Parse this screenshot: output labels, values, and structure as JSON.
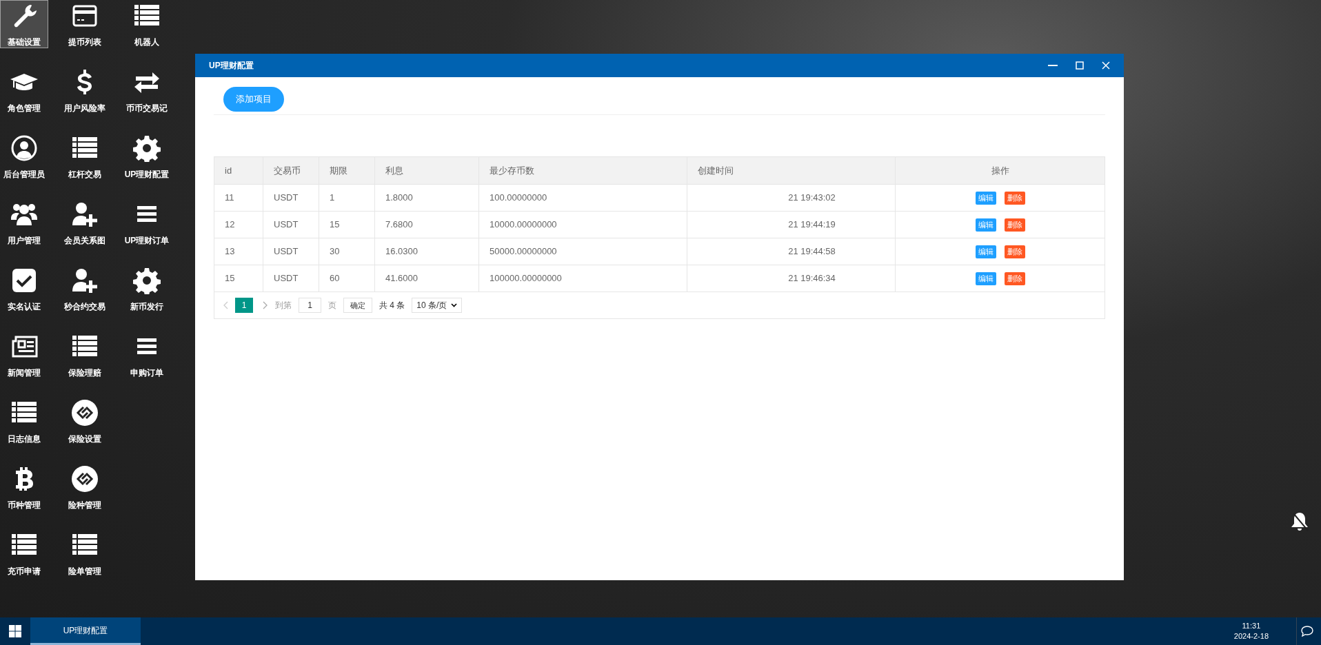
{
  "sidebar": {
    "rows": [
      {
        "items": [
          {
            "label": "基础设置",
            "kind": "wrench",
            "selected": true
          },
          {
            "label": "提币列表",
            "kind": "card",
            "selected": false
          },
          {
            "label": "机器人",
            "kind": "list",
            "selected": false
          }
        ]
      },
      {
        "items": [
          {
            "label": "角色管理",
            "kind": "cap",
            "selected": false
          },
          {
            "label": "用户风险率",
            "kind": "dollar",
            "selected": false
          },
          {
            "label": "币币交易记",
            "kind": "exchange",
            "selected": false
          }
        ]
      },
      {
        "items": [
          {
            "label": "后台管理员",
            "kind": "usercircle",
            "selected": false
          },
          {
            "label": "杠杆交易",
            "kind": "list",
            "selected": false
          },
          {
            "label": "UP理财配置",
            "kind": "gear",
            "selected": false
          }
        ]
      },
      {
        "items": [
          {
            "label": "用户管理",
            "kind": "users",
            "selected": false
          },
          {
            "label": "会员关系图",
            "kind": "useradd",
            "selected": false
          },
          {
            "label": "UP理财订单",
            "kind": "bars",
            "selected": false
          }
        ]
      },
      {
        "items": [
          {
            "label": "实名认证",
            "kind": "check",
            "selected": false
          },
          {
            "label": "秒合约交易",
            "kind": "useradd",
            "selected": false
          },
          {
            "label": "新币发行",
            "kind": "gear",
            "selected": false
          }
        ]
      },
      {
        "items": [
          {
            "label": "新闻管理",
            "kind": "news",
            "selected": false
          },
          {
            "label": "保险理赔",
            "kind": "list",
            "selected": false
          },
          {
            "label": "申购订单",
            "kind": "bars",
            "selected": false
          }
        ]
      },
      {
        "items": [
          {
            "label": "日志信息",
            "kind": "list",
            "selected": false
          },
          {
            "label": "保险设置",
            "kind": "link",
            "selected": false
          }
        ]
      },
      {
        "items": [
          {
            "label": "币种管理",
            "kind": "bitcoin",
            "selected": false
          },
          {
            "label": "险种管理",
            "kind": "link",
            "selected": false
          }
        ]
      },
      {
        "items": [
          {
            "label": "充币申请",
            "kind": "list",
            "selected": false
          },
          {
            "label": "险单管理",
            "kind": "list",
            "selected": false
          }
        ]
      }
    ]
  },
  "window": {
    "title": "UP理财配置",
    "add_button": "添加项目",
    "table": {
      "columns": [
        "id",
        "交易币",
        "期限",
        "利息",
        "最少存币数",
        "创建时间",
        "操作"
      ],
      "rows": [
        {
          "cells": [
            "11",
            "USDT",
            "1",
            "1.8000",
            "100.00000000",
            "21 19:43:02"
          ],
          "actions": [
            "编辑",
            "删除"
          ]
        },
        {
          "cells": [
            "12",
            "USDT",
            "15",
            "7.6800",
            "10000.00000000",
            "21 19:44:19"
          ],
          "actions": [
            "编辑",
            "删除"
          ]
        },
        {
          "cells": [
            "13",
            "USDT",
            "30",
            "16.0300",
            "50000.00000000",
            "21 19:44:58"
          ],
          "actions": [
            "编辑",
            "删除"
          ]
        },
        {
          "cells": [
            "15",
            "USDT",
            "60",
            "41.6000",
            "100000.00000000",
            "21 19:46:34"
          ],
          "actions": [
            "编辑",
            "删除"
          ]
        }
      ]
    },
    "pagination": {
      "pages": [
        {
          "label": "1",
          "selected": true
        }
      ],
      "goto_label": "到第",
      "goto_value": "1",
      "page_unit": "页",
      "confirm": "确定",
      "total": "共 4 条",
      "page_size": "10 条/页"
    }
  },
  "taskbar": {
    "tasks": [
      {
        "label": "UP理财配置",
        "selected": true
      }
    ],
    "time": "11:31",
    "date": "2024-2-18"
  }
}
